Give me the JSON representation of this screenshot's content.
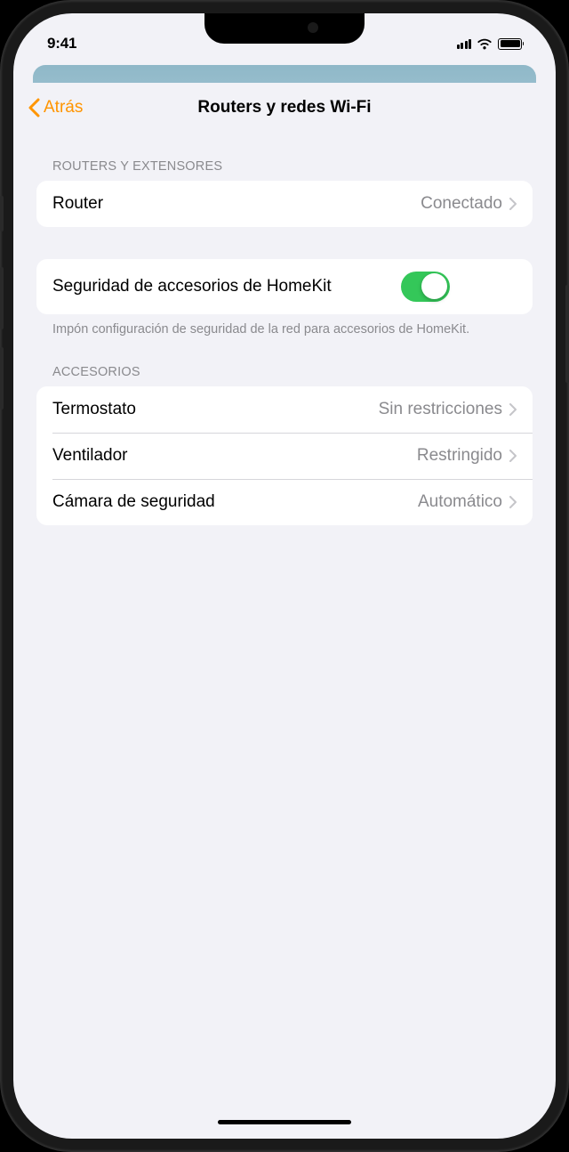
{
  "status": {
    "time": "9:41"
  },
  "nav": {
    "back_label": "Atrás",
    "title": "Routers y redes Wi-Fi"
  },
  "sections": {
    "routers_header": "ROUTERS Y EXTENSORES",
    "accessories_header": "ACCESORIOS",
    "security_footer": "Impón configuración de seguridad de la red para accesorios de HomeKit."
  },
  "rows": {
    "router": {
      "label": "Router",
      "value": "Conectado"
    },
    "security": {
      "label": "Seguridad de accesorios de HomeKit",
      "toggle": true
    },
    "thermostat": {
      "label": "Termostato",
      "value": "Sin restricciones"
    },
    "fan": {
      "label": "Ventilador",
      "value": "Restringido"
    },
    "camera": {
      "label": "Cámara de seguridad",
      "value": "Automático"
    }
  },
  "colors": {
    "accent": "#ff9500",
    "toggle_on": "#34c759",
    "bg": "#f2f2f7"
  }
}
